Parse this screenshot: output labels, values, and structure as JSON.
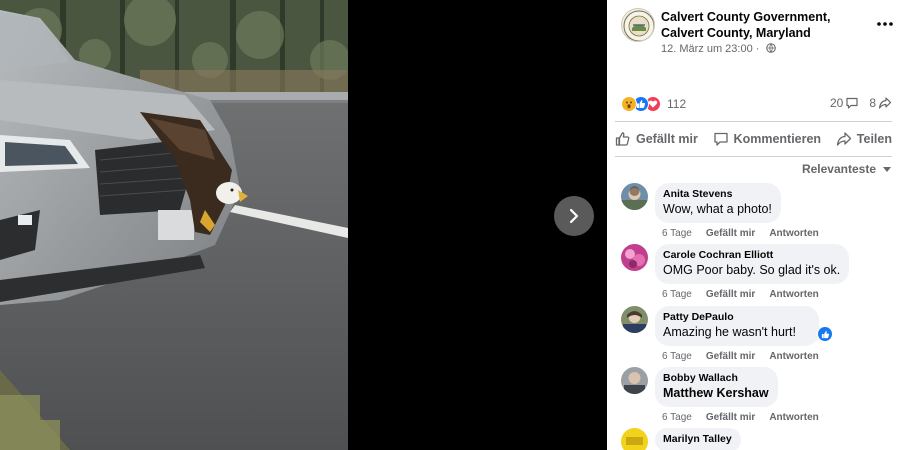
{
  "viewer": {
    "next_icon": "chevron-right-icon"
  },
  "post": {
    "page_name": "Calvert County Government, Calvert County, Maryland",
    "timestamp": "12. März um 23:00 ·",
    "privacy_icon": "globe-icon",
    "more_icon": "more-horizontal-icon",
    "reactions": {
      "types": [
        "wow",
        "like",
        "love"
      ],
      "count": "112"
    },
    "comment_count": "20",
    "share_count": "8",
    "actions": {
      "like": "Gefällt mir",
      "comment": "Kommentieren",
      "share": "Teilen"
    },
    "sort_label": "Relevanteste"
  },
  "comments": [
    {
      "author": "Anita Stevens",
      "text": "Wow, what a photo!",
      "time": "6 Tage",
      "like": "Gefällt mir",
      "reply": "Antworten"
    },
    {
      "author": "Carole Cochran Elliott",
      "text": "OMG Poor baby. So glad it's ok.",
      "time": "6 Tage",
      "like": "Gefällt mir",
      "reply": "Antworten"
    },
    {
      "author": "Patty DePaulo",
      "text": "Amazing he wasn't hurt!",
      "time": "6 Tage",
      "like": "Gefällt mir",
      "reply": "Antworten",
      "reaction": "like"
    },
    {
      "author": "Bobby Wallach",
      "text": "Matthew Kershaw",
      "time": "6 Tage",
      "like": "Gefällt mir",
      "reply": "Antworten"
    },
    {
      "author": "Marilyn Talley"
    }
  ],
  "colors": {
    "brand_blue": "#1877f2",
    "love_red": "#f33e58",
    "wow_yellow": "#f7b125",
    "secondary_text": "#65676b",
    "bubble_bg": "#f0f2f5"
  }
}
